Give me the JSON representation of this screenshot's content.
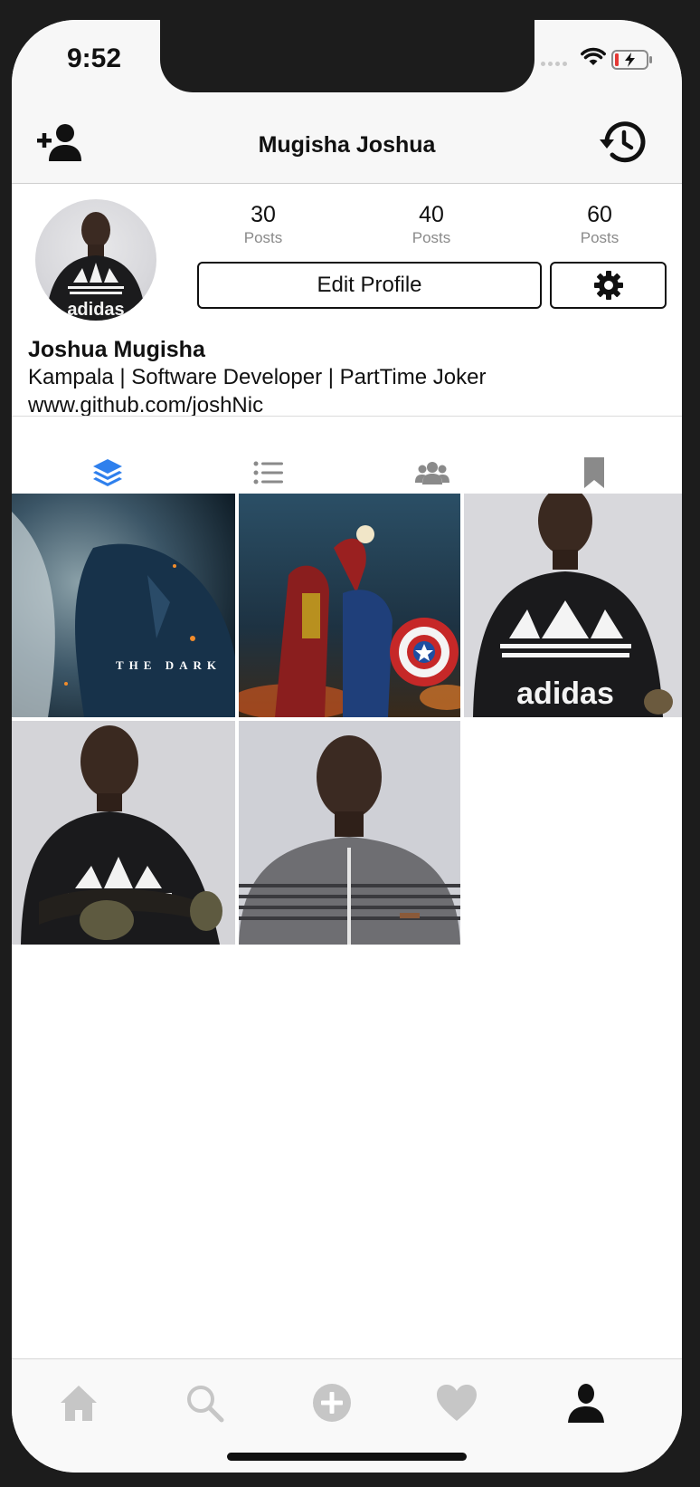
{
  "status_bar": {
    "time": "9:52"
  },
  "header": {
    "title": "Mugisha Joshua",
    "left_icon": "add-user-icon",
    "right_icon": "history-icon"
  },
  "profile": {
    "stats": [
      {
        "value": "30",
        "label": "Posts"
      },
      {
        "value": "40",
        "label": "Posts"
      },
      {
        "value": "60",
        "label": "Posts"
      }
    ],
    "edit_label": "Edit Profile",
    "settings_icon": "gear-icon",
    "name": "Joshua Mugisha",
    "bio": "Kampala | Software Developer | PartTime Joker",
    "website": "www.github.com/joshNic",
    "avatar_text": "adidas"
  },
  "tabs": [
    {
      "icon": "layers-icon",
      "active": true
    },
    {
      "icon": "list-icon",
      "active": false
    },
    {
      "icon": "group-icon",
      "active": false
    },
    {
      "icon": "bookmark-icon",
      "active": false
    }
  ],
  "grid": {
    "posts": [
      {
        "kind": "joker-poster",
        "caption": "THE DARK"
      },
      {
        "kind": "avengers-poster"
      },
      {
        "kind": "adidas-portrait",
        "caption": "adidas"
      },
      {
        "kind": "arms-crossed-portrait"
      },
      {
        "kind": "shirt-portrait"
      }
    ]
  },
  "tabbar": {
    "items": [
      "home-icon",
      "search-icon",
      "add-circle-icon",
      "heart-icon",
      "person-icon"
    ],
    "active": "person-icon"
  },
  "colors": {
    "accent": "#2f80ed",
    "inactive_icon": "#c6c6c6",
    "text": "#111111",
    "secondary_text": "#8a8a8a"
  }
}
